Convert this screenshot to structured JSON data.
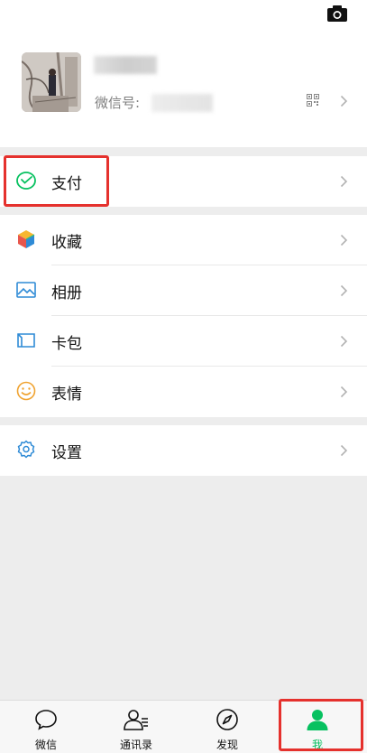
{
  "profile": {
    "wechat_id_label": "微信号:"
  },
  "menu": {
    "pay": "支付",
    "favorites": "收藏",
    "album": "相册",
    "cards": "卡包",
    "stickers": "表情",
    "settings": "设置"
  },
  "tabs": [
    {
      "label": "微信",
      "icon": "chat-bubble-icon"
    },
    {
      "label": "通讯录",
      "icon": "contacts-icon"
    },
    {
      "label": "发现",
      "icon": "compass-icon"
    },
    {
      "label": "我",
      "icon": "person-icon"
    }
  ],
  "colors": {
    "accent": "#07c160",
    "highlight": "#e5312d",
    "background": "#ededed"
  }
}
